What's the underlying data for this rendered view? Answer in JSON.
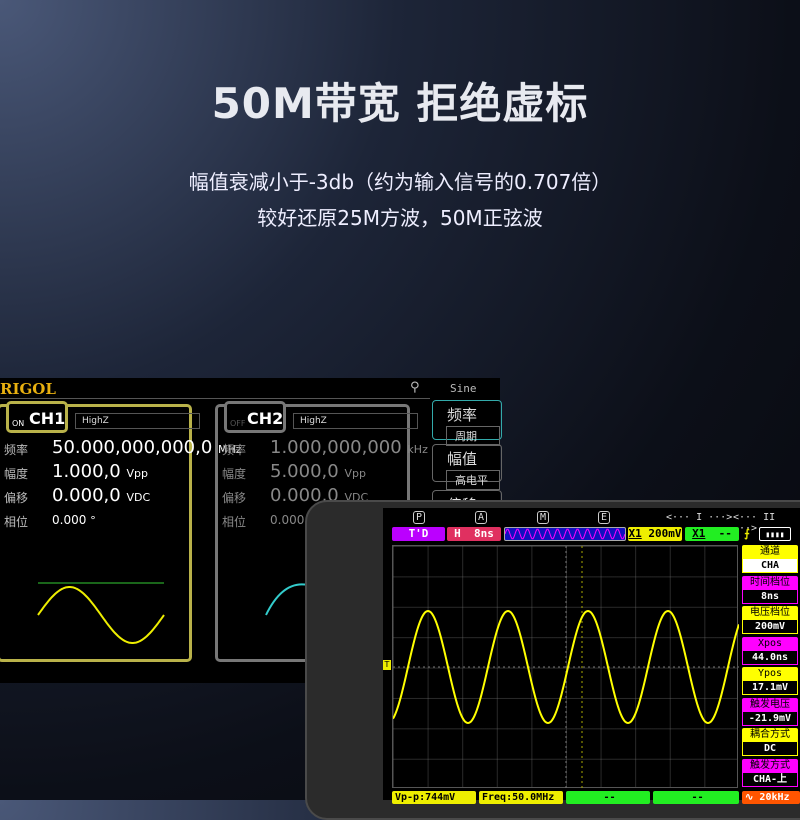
{
  "hero": {
    "title": "50M带宽 拒绝虚标",
    "line1": "幅值衰减小于-3db（约为输入信号的0.707倍）",
    "line2": "较好还原25M方波，50M正弦波"
  },
  "generator": {
    "brand": "RIGOL",
    "waveform": "Sine",
    "ch1": {
      "name": "CH1",
      "state": "ON",
      "load": "HighZ",
      "rows": [
        {
          "label": "频率",
          "value": "50.000,000,000,0",
          "unit": "MHz"
        },
        {
          "label": "幅度",
          "value": "1.000,0",
          "unit": "Vpp"
        },
        {
          "label": "偏移",
          "value": "0.000,0",
          "unit": "VDC"
        },
        {
          "label": "相位",
          "value": "0.000",
          "unit": "°"
        }
      ]
    },
    "ch2": {
      "name": "CH2",
      "state": "OFF",
      "load": "HighZ",
      "rows": [
        {
          "label": "频率",
          "value": "1.000,000,000",
          "unit": "kHz"
        },
        {
          "label": "幅度",
          "value": "5.000,0",
          "unit": "Vpp"
        },
        {
          "label": "偏移",
          "value": "0.000,0",
          "unit": "VDC"
        },
        {
          "label": "相位",
          "value": "0.000",
          "unit": "°"
        }
      ]
    },
    "menu": [
      {
        "label": "频率",
        "sub": "周期"
      },
      {
        "label": "幅值",
        "sub": "高电平"
      },
      {
        "label": "偏移"
      }
    ]
  },
  "scope": {
    "keys": [
      "P",
      "A",
      "M",
      "E"
    ],
    "cursor1": "<··· I ···>",
    "cursor2": "<··· II ···>",
    "topbar": {
      "mode": "T'D",
      "timebase_label": "H",
      "timebase": "8ns",
      "ch_x1": "X1",
      "volt": "200mV",
      "ch2_x1": "X1",
      "ch2": "--"
    },
    "panel": [
      {
        "label": "通道",
        "value": "CHA",
        "color": "#ffff00"
      },
      {
        "label": "时间档位",
        "value": "8ns",
        "color": "#ff00ff"
      },
      {
        "label": "电压档位",
        "value": "200mV",
        "color": "#ffff00"
      },
      {
        "label": "Xpos",
        "value": "44.0ns",
        "color": "#ff00ff"
      },
      {
        "label": "Ypos",
        "value": "17.1mV",
        "color": "#ffff00"
      },
      {
        "label": "触发电压",
        "value": "-21.9mV",
        "color": "#ff00ff"
      },
      {
        "label": "耦合方式",
        "value": "DC",
        "color": "#ffff00"
      },
      {
        "label": "触发方式",
        "value": "CHA-上",
        "color": "#ff00ff"
      }
    ],
    "bottom": {
      "vpp": "Vp-p:744mV",
      "freq": "Freq:50.0MHz",
      "m3": "--",
      "m4": "--",
      "gen": "20kHz"
    },
    "colors": {
      "trace": "#ffff00",
      "magenta": "#ff00ff",
      "green": "#22ee22",
      "orange": "#ff5500"
    }
  }
}
